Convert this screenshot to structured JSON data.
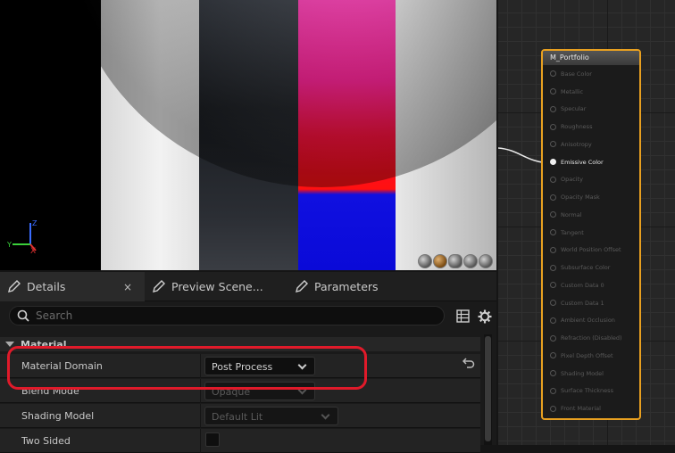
{
  "graph": {
    "node": {
      "title": "M_Portfolio",
      "pins": [
        {
          "label": "Base Color",
          "active": false
        },
        {
          "label": "Metallic",
          "active": false
        },
        {
          "label": "Specular",
          "active": false
        },
        {
          "label": "Roughness",
          "active": false
        },
        {
          "label": "Anisotropy",
          "active": false
        },
        {
          "label": "Emissive Color",
          "active": true
        },
        {
          "label": "Opacity",
          "active": false
        },
        {
          "label": "Opacity Mask",
          "active": false
        },
        {
          "label": "Normal",
          "active": false
        },
        {
          "label": "Tangent",
          "active": false
        },
        {
          "label": "World Position Offset",
          "active": false
        },
        {
          "label": "Subsurface Color",
          "active": false
        },
        {
          "label": "Custom Data 0",
          "active": false
        },
        {
          "label": "Custom Data 1",
          "active": false
        },
        {
          "label": "Ambient Occlusion",
          "active": false
        },
        {
          "label": "Refraction (Disabled)",
          "active": false
        },
        {
          "label": "Pixel Depth Offset",
          "active": false
        },
        {
          "label": "Shading Model",
          "active": false
        },
        {
          "label": "Surface Thickness",
          "active": false
        },
        {
          "label": "Front Material",
          "active": false
        }
      ]
    }
  },
  "tabs": {
    "details": "Details",
    "details_close": "×",
    "preview": "Preview Scene...",
    "parameters": "Parameters"
  },
  "search": {
    "placeholder": "Search"
  },
  "section": {
    "title": "Material"
  },
  "properties": {
    "material_domain": {
      "label": "Material Domain",
      "value": "Post Process"
    },
    "blend_mode": {
      "label": "Blend Mode",
      "value": "Opaque"
    },
    "shading_model": {
      "label": "Shading Model",
      "value": "Default Lit"
    },
    "two_sided": {
      "label": "Two Sided"
    }
  },
  "gizmo": {
    "x": "X",
    "y": "Y",
    "z": "Z"
  },
  "colors": {
    "accent": "#e8a020",
    "highlight": "#e01a2a"
  }
}
